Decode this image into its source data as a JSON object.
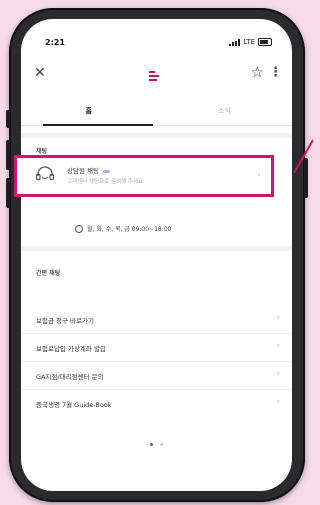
{
  "status": {
    "time": "2:21",
    "network": "LTE"
  },
  "header": {
    "close_icon": "close-icon",
    "logo_icon": "app-logo",
    "star_icon": "star-outline-icon",
    "menu_icon": "more-vertical-icon"
  },
  "tabs": [
    {
      "label": "홈"
    },
    {
      "label": "소식"
    }
  ],
  "service": {
    "section_label": "채팅",
    "card_title": "상담원 채팅",
    "card_subtitle": "고객센터 채팅으로 문의해 주세요.",
    "hours": "월, 화, 수, 목, 금 09:00~18:00"
  },
  "quick": {
    "section_label": "간편 채팅",
    "items": [
      {
        "label": "보험금 청구 바로가기"
      },
      {
        "label": "보험료납입 가상계좌 발급"
      },
      {
        "label": "GA지점/대리점센터 문의"
      },
      {
        "label": "중국생명 7월 Guide-Book"
      }
    ]
  },
  "pagination": {
    "total": 2,
    "active": 1
  },
  "colors": {
    "accent": "#d1126f",
    "brand": "#c2185b",
    "background": "#f6dbe6"
  }
}
